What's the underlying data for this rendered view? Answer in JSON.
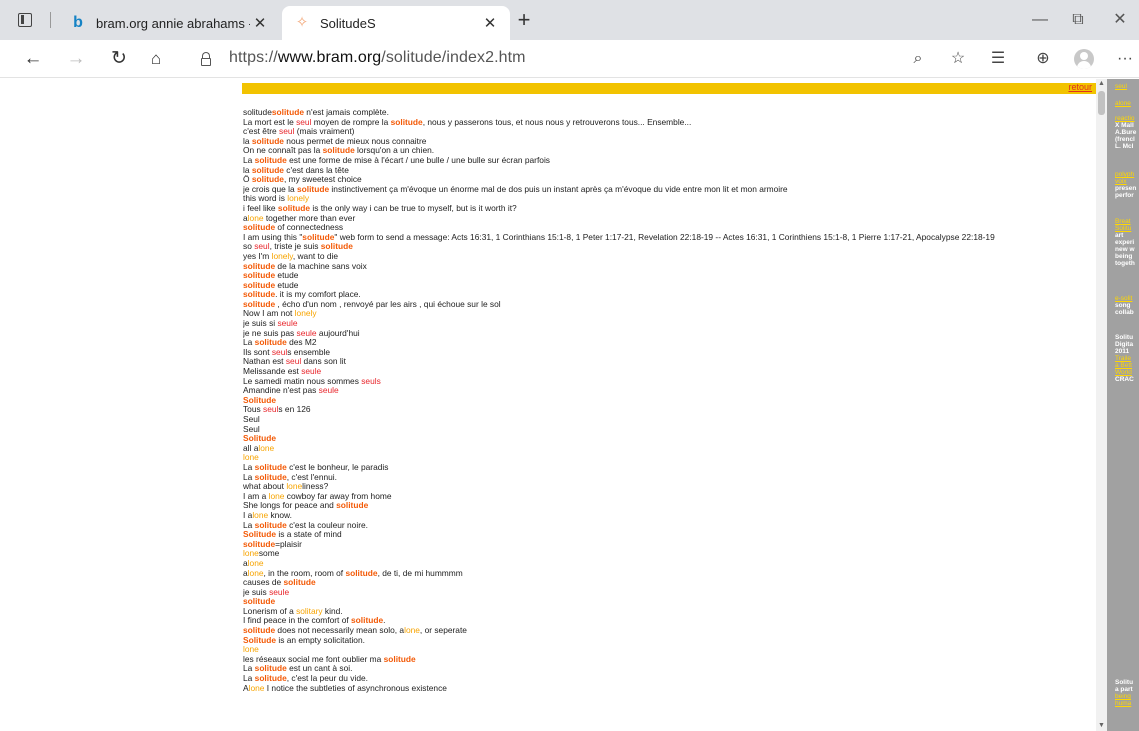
{
  "browser": {
    "tabs": [
      {
        "title": "bram.org annie abrahams - Bing",
        "active": false,
        "favicon": "bing-icon"
      },
      {
        "title": "SolitudeS",
        "active": true,
        "favicon": "solitude-favicon"
      }
    ],
    "new_tab": "+",
    "window_controls": {
      "minimize": "—",
      "restore": "⧉",
      "close": "✕"
    },
    "address": {
      "scheme": "https://",
      "host": "www.bram.org",
      "path": "/solitude/index2.htm"
    },
    "more_label": "···"
  },
  "page": {
    "retour": "retour",
    "colors": {
      "solitude": "#f35a07",
      "seul": "#e8252b",
      "lone": "#f7a400",
      "bar": "#f2c300",
      "sidebar": "#a1a1a1"
    },
    "lines": [
      [
        [
          "solitude"
        ],
        [
          "s",
          "solitude"
        ],
        [
          " n'est jamais complète."
        ]
      ],
      [
        [
          "La mort est le "
        ],
        [
          "r",
          "seul"
        ],
        [
          " moyen de rompre la "
        ],
        [
          "s",
          "solitude"
        ],
        [
          ", nous y passerons tous, et nous nous y retrouverons tous... Ensemble..."
        ]
      ],
      [
        [
          "c'est être "
        ],
        [
          "r",
          "seul"
        ],
        [
          " (mais vraiment)"
        ]
      ],
      [
        [
          "la "
        ],
        [
          "s",
          "solitude"
        ],
        [
          " nous permet de mieux nous connaitre"
        ]
      ],
      [
        [
          "On ne connaît pas la "
        ],
        [
          "s",
          "solitude"
        ],
        [
          " lorsqu'on a un chien."
        ]
      ],
      [
        [
          "La "
        ],
        [
          "s",
          "solitude"
        ],
        [
          " est une forme de mise à l'écart / une bulle / une bulle sur écran parfois"
        ]
      ],
      [
        [
          "la "
        ],
        [
          "s",
          "solitude"
        ],
        [
          " c'est dans la tête"
        ]
      ],
      [
        [
          "Ô "
        ],
        [
          "s",
          "solitude"
        ],
        [
          ", my sweetest choice"
        ]
      ],
      [
        [
          "je crois que la "
        ],
        [
          "s",
          "solitude"
        ],
        [
          " instinctivement ça m'évoque un énorme mal de dos puis un instant après ça m'évoque du vide entre mon lit et mon armoire"
        ]
      ],
      [
        [
          "this word is "
        ],
        [
          "y",
          "lonely"
        ]
      ],
      [
        [
          "i feel like "
        ],
        [
          "s",
          "solitude"
        ],
        [
          " is the only way i can be true to myself, but is it worth it?"
        ]
      ],
      [
        [
          "a"
        ],
        [
          "y",
          "lone"
        ],
        [
          " together more than ever"
        ]
      ],
      [
        [
          "s",
          "solitude"
        ],
        [
          " of connectedness"
        ]
      ],
      [
        [
          "I am using this \""
        ],
        [
          "s",
          "solitude"
        ],
        [
          "\" web form to send a message: Acts 16:31, 1 Corinthians 15:1-8, 1 Peter 1:17-21, Revelation 22:18-19 -- Actes 16:31, 1 Corinthiens 15:1-8, 1 Pierre 1:17-21, Apocalypse 22:18-19"
        ]
      ],
      [
        [
          "so "
        ],
        [
          "r",
          "seul"
        ],
        [
          ", triste je suis "
        ],
        [
          "s",
          "solitude"
        ]
      ],
      [
        [
          "yes I'm "
        ],
        [
          "y",
          "lonely"
        ],
        [
          ", want to die"
        ]
      ],
      [
        [
          "s",
          "solitude"
        ],
        [
          " de la machine sans voix"
        ]
      ],
      [
        [
          "s",
          "solitude"
        ],
        [
          " etude"
        ]
      ],
      [
        [
          "s",
          "solitude"
        ],
        [
          " etude"
        ]
      ],
      [
        [
          "s",
          "solitude"
        ],
        [
          ". it is my comfort place."
        ]
      ],
      [
        [
          "s",
          "solitude"
        ],
        [
          " , écho d'un nom , renvoyé par les airs , qui échoue sur le sol"
        ]
      ],
      [
        [
          "Now I am not "
        ],
        [
          "y",
          "lonely"
        ]
      ],
      [
        [
          "je suis si "
        ],
        [
          "r",
          "seule"
        ]
      ],
      [
        [
          "je ne suis pas "
        ],
        [
          "r",
          "seule"
        ],
        [
          " aujourd'hui"
        ]
      ],
      [
        [
          "La "
        ],
        [
          "s",
          "solitude"
        ],
        [
          " des M2"
        ]
      ],
      [
        [
          "Ils sont "
        ],
        [
          "r",
          "seul"
        ],
        [
          "s ensemble"
        ]
      ],
      [
        [
          "Nathan est "
        ],
        [
          "r",
          "seul"
        ],
        [
          " dans son lit"
        ]
      ],
      [
        [
          "Melissande est "
        ],
        [
          "r",
          "seule"
        ]
      ],
      [
        [
          "Le samedi matin nous sommes "
        ],
        [
          "r",
          "seuls"
        ]
      ],
      [
        [
          "Amandine n'est pas "
        ],
        [
          "r",
          "seule"
        ]
      ],
      [
        [
          "s",
          "Solitude"
        ]
      ],
      [
        [
          "Tous "
        ],
        [
          "r",
          "seul"
        ],
        [
          "s en 126"
        ]
      ],
      [
        [
          "Seul"
        ]
      ],
      [
        [
          "Seul"
        ]
      ],
      [
        [
          "s",
          "Solitude"
        ]
      ],
      [
        [
          "all a"
        ],
        [
          "y",
          "lone"
        ]
      ],
      [
        [
          "y",
          "lone"
        ]
      ],
      [
        [
          "La "
        ],
        [
          "s",
          "solitude"
        ],
        [
          " c'est le bonheur, le paradis"
        ]
      ],
      [
        [
          "La "
        ],
        [
          "s",
          "solitude"
        ],
        [
          ", c'est l'ennui."
        ]
      ],
      [
        [
          "what about "
        ],
        [
          "y",
          "lone"
        ],
        [
          "liness?"
        ]
      ],
      [
        [
          "I am a "
        ],
        [
          "y",
          "lone"
        ],
        [
          " cowboy far away from home"
        ]
      ],
      [
        [
          "She longs for peace and "
        ],
        [
          "s",
          "solitude"
        ]
      ],
      [
        [
          "I a"
        ],
        [
          "y",
          "lone"
        ],
        [
          " know."
        ]
      ],
      [
        [
          "La "
        ],
        [
          "s",
          "solitude"
        ],
        [
          " c'est la couleur noire."
        ]
      ],
      [
        [
          "s",
          "Solitude"
        ],
        [
          " is a state of mind"
        ]
      ],
      [
        [
          "s",
          "solitude"
        ],
        [
          "=plaisir"
        ]
      ],
      [
        [
          "y",
          "lone"
        ],
        [
          "some"
        ]
      ],
      [
        [
          "a"
        ],
        [
          "y",
          "lone"
        ]
      ],
      [
        [
          "a"
        ],
        [
          "y",
          "lone"
        ],
        [
          ", in the room, room of "
        ],
        [
          "s",
          "solitude"
        ],
        [
          ", de ti, de mi hummmm"
        ]
      ],
      [
        [
          "causes de "
        ],
        [
          "s",
          "solitude"
        ]
      ],
      [
        [
          "je suis "
        ],
        [
          "r",
          "seule"
        ]
      ],
      [
        [
          "s",
          "solitude"
        ]
      ],
      [
        [
          "Lonerism of a "
        ],
        [
          "y",
          "solitary"
        ],
        [
          " kind."
        ]
      ],
      [
        [
          "I find peace in the comfort of "
        ],
        [
          "s",
          "solitude"
        ],
        [
          "."
        ]
      ],
      [
        [
          "s",
          "solitude"
        ],
        [
          " does not necessarily mean solo, a"
        ],
        [
          "y",
          "lone"
        ],
        [
          ", or seperate"
        ]
      ],
      [
        [
          "s",
          "Solitude"
        ],
        [
          " is an empty solicitation."
        ]
      ],
      [
        [
          "y",
          "lone"
        ]
      ],
      [
        [
          "les réseaux social me font oublier ma "
        ],
        [
          "s",
          "solitude"
        ]
      ],
      [
        [
          "La "
        ],
        [
          "s",
          "solitude"
        ],
        [
          " est un cant à soi."
        ]
      ],
      [
        [
          "La "
        ],
        [
          "s",
          "solitude"
        ],
        [
          ", c'est la peur du vide."
        ]
      ],
      [
        [
          "A"
        ],
        [
          "y",
          "lone"
        ],
        [
          " I notice the subtleties of asynchronous existence"
        ]
      ]
    ],
    "sidebar": [
      {
        "text": "seul",
        "link": true
      },
      {
        "text": "alone",
        "link": true
      },
      {
        "text": "reactio",
        "link": true
      },
      {
        "text": "X Mall",
        "link": false,
        "bold": true
      },
      {
        "text": "A.Bure",
        "link": false,
        "bold": true
      },
      {
        "text": "(frencl",
        "link": false,
        "bold": true
      },
      {
        "text": "L. Mcl",
        "link": false,
        "bold": true
      },
      {
        "text": "polyph",
        "link": true
      },
      {
        "text": "voix",
        "link": true
      },
      {
        "text": "presen",
        "link": false,
        "bold": true
      },
      {
        "text": "perfor",
        "link": false,
        "bold": true
      },
      {
        "text": "Breat",
        "link": true
      },
      {
        "text": "Solitu",
        "link": true
      },
      {
        "text": "art",
        "link": false,
        "bold": true
      },
      {
        "text": "experi",
        "link": false,
        "bold": true
      },
      {
        "text": "new w",
        "link": false,
        "bold": true
      },
      {
        "text": "being",
        "link": false,
        "bold": true
      },
      {
        "text": "togeth",
        "link": false,
        "bold": true
      },
      {
        "text": "e-solit",
        "link": true
      },
      {
        "text": "song",
        "link": false,
        "bold": true
      },
      {
        "text": "collab",
        "link": false,
        "bold": true
      },
      {
        "text": "Solitu",
        "link": false,
        "bold": true
      },
      {
        "text": "Digita",
        "link": false,
        "bold": true
      },
      {
        "text": "2011",
        "link": false,
        "bold": true
      },
      {
        "text": "Traile",
        "link": true
      },
      {
        "text": "a Bett",
        "link": true
      },
      {
        "text": "World",
        "link": true
      },
      {
        "text": "CRAC",
        "link": false,
        "bold": true
      },
      {
        "text": "Solitu",
        "link": false,
        "bold": true
      },
      {
        "text": "a part",
        "link": false,
        "bold": true
      },
      {
        "text": "being",
        "link": true
      },
      {
        "text": "huma",
        "link": true
      }
    ]
  }
}
